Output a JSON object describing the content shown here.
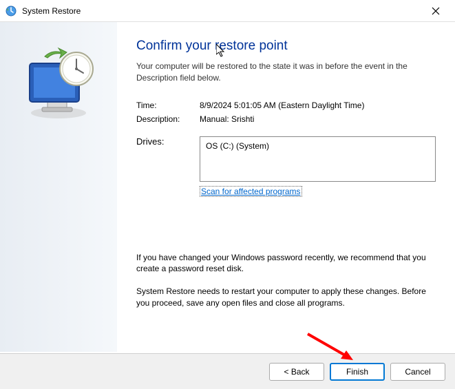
{
  "titlebar": {
    "title": "System Restore"
  },
  "main": {
    "heading": "Confirm your restore point",
    "subtext": "Your computer will be restored to the state it was in before the event in the Description field below.",
    "time_label": "Time:",
    "time_value": "8/9/2024 5:01:05 AM (Eastern Daylight Time)",
    "description_label": "Description:",
    "description_value": "Manual: Srishti",
    "drives_label": "Drives:",
    "drives_value": "OS (C:) (System)",
    "scan_link": "Scan for affected programs",
    "note1": "If you have changed your Windows password recently, we recommend that you create a password reset disk.",
    "note2": "System Restore needs to restart your computer to apply these changes. Before you proceed, save any open files and close all programs."
  },
  "footer": {
    "back": "< Back",
    "finish": "Finish",
    "cancel": "Cancel"
  }
}
